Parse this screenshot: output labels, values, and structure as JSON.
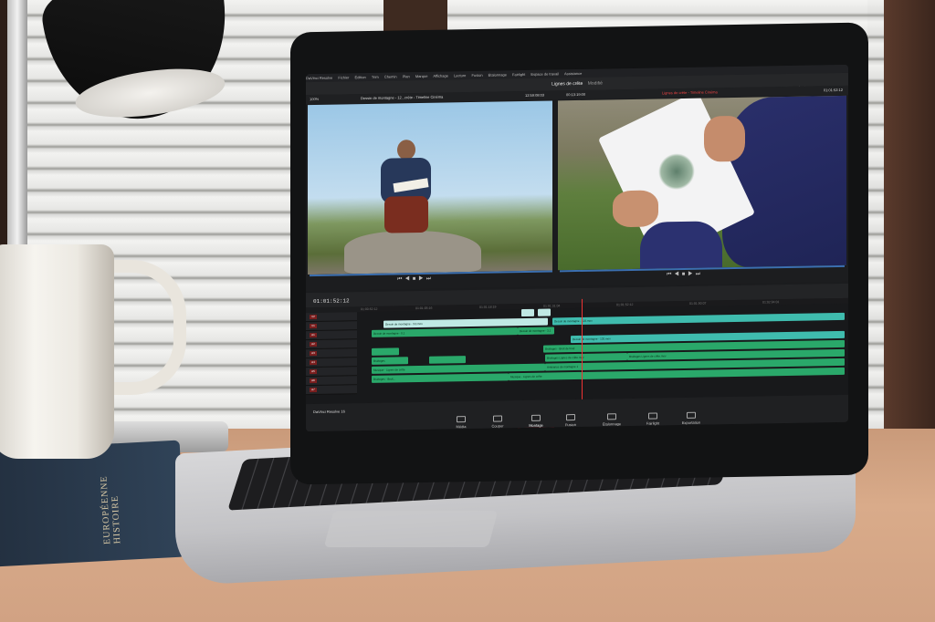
{
  "app": {
    "menu": [
      "DaVinci Resolve",
      "Fichier",
      "Édition",
      "Trim",
      "Chemin",
      "Plan",
      "Marque",
      "Affichage",
      "Lecture",
      "Fusion",
      "Étalonnage",
      "Fairlight",
      "Espace de travail",
      "Assistance"
    ],
    "project_title": "Lignes de crête",
    "subtitle": "Modifié",
    "right_buttons": [
      "Métadonnées",
      "Inspecteur"
    ],
    "zoom_left": "100%",
    "source_tc": "00:01:17:39",
    "source_clip": "Dessin de montagne - 12...crête - Timeline Cinéma",
    "source_duration": "12:59:08:03",
    "program_zoom": "100%",
    "program_tc_left": "00:13:19:00",
    "program_timeline": "Lignes de crête - Timeline Cinéma",
    "program_tc": "01:01:52:12",
    "timeline_tc": "01:01:52:12",
    "ruler": [
      "01:00:52:12",
      "01:01:05:16",
      "01:01:18:19",
      "01:01:31:04",
      "01:01:52:12",
      "01:01:50:07",
      "01:02:04:01"
    ],
    "track_tags": [
      "V2",
      "V1",
      "A1",
      "A2",
      "A3",
      "A4",
      "A5",
      "A6",
      "A7"
    ],
    "clips_v": [
      "Dessin de montagne - 3.0.mov"
    ],
    "clips_a": [
      "Dessin de montagne - 0.1",
      "Dessin de montagne - 3.1",
      "Dessin de montagne - 122.mov",
      "Dessin de montagne - 120.mov",
      "Bruitages - Bruit de fond",
      "Bruitages",
      "Bruitages Lignes de crête.mov",
      "Bruitages Lignes de crête.mov",
      "Musique - Lignes de crête",
      "Ambiance de montagne 1",
      "Bruitages - Bruit...",
      "Musique - Lignes de crête"
    ],
    "brand": "DaVinci Resolve 16",
    "pages": [
      "Média",
      "Couper",
      "Montage",
      "Fusion",
      "Étalonnage",
      "Fairlight",
      "Exportation"
    ],
    "active_page": "Montage"
  },
  "book": {
    "title": "EUROPÉENNE HISTOIRE"
  }
}
